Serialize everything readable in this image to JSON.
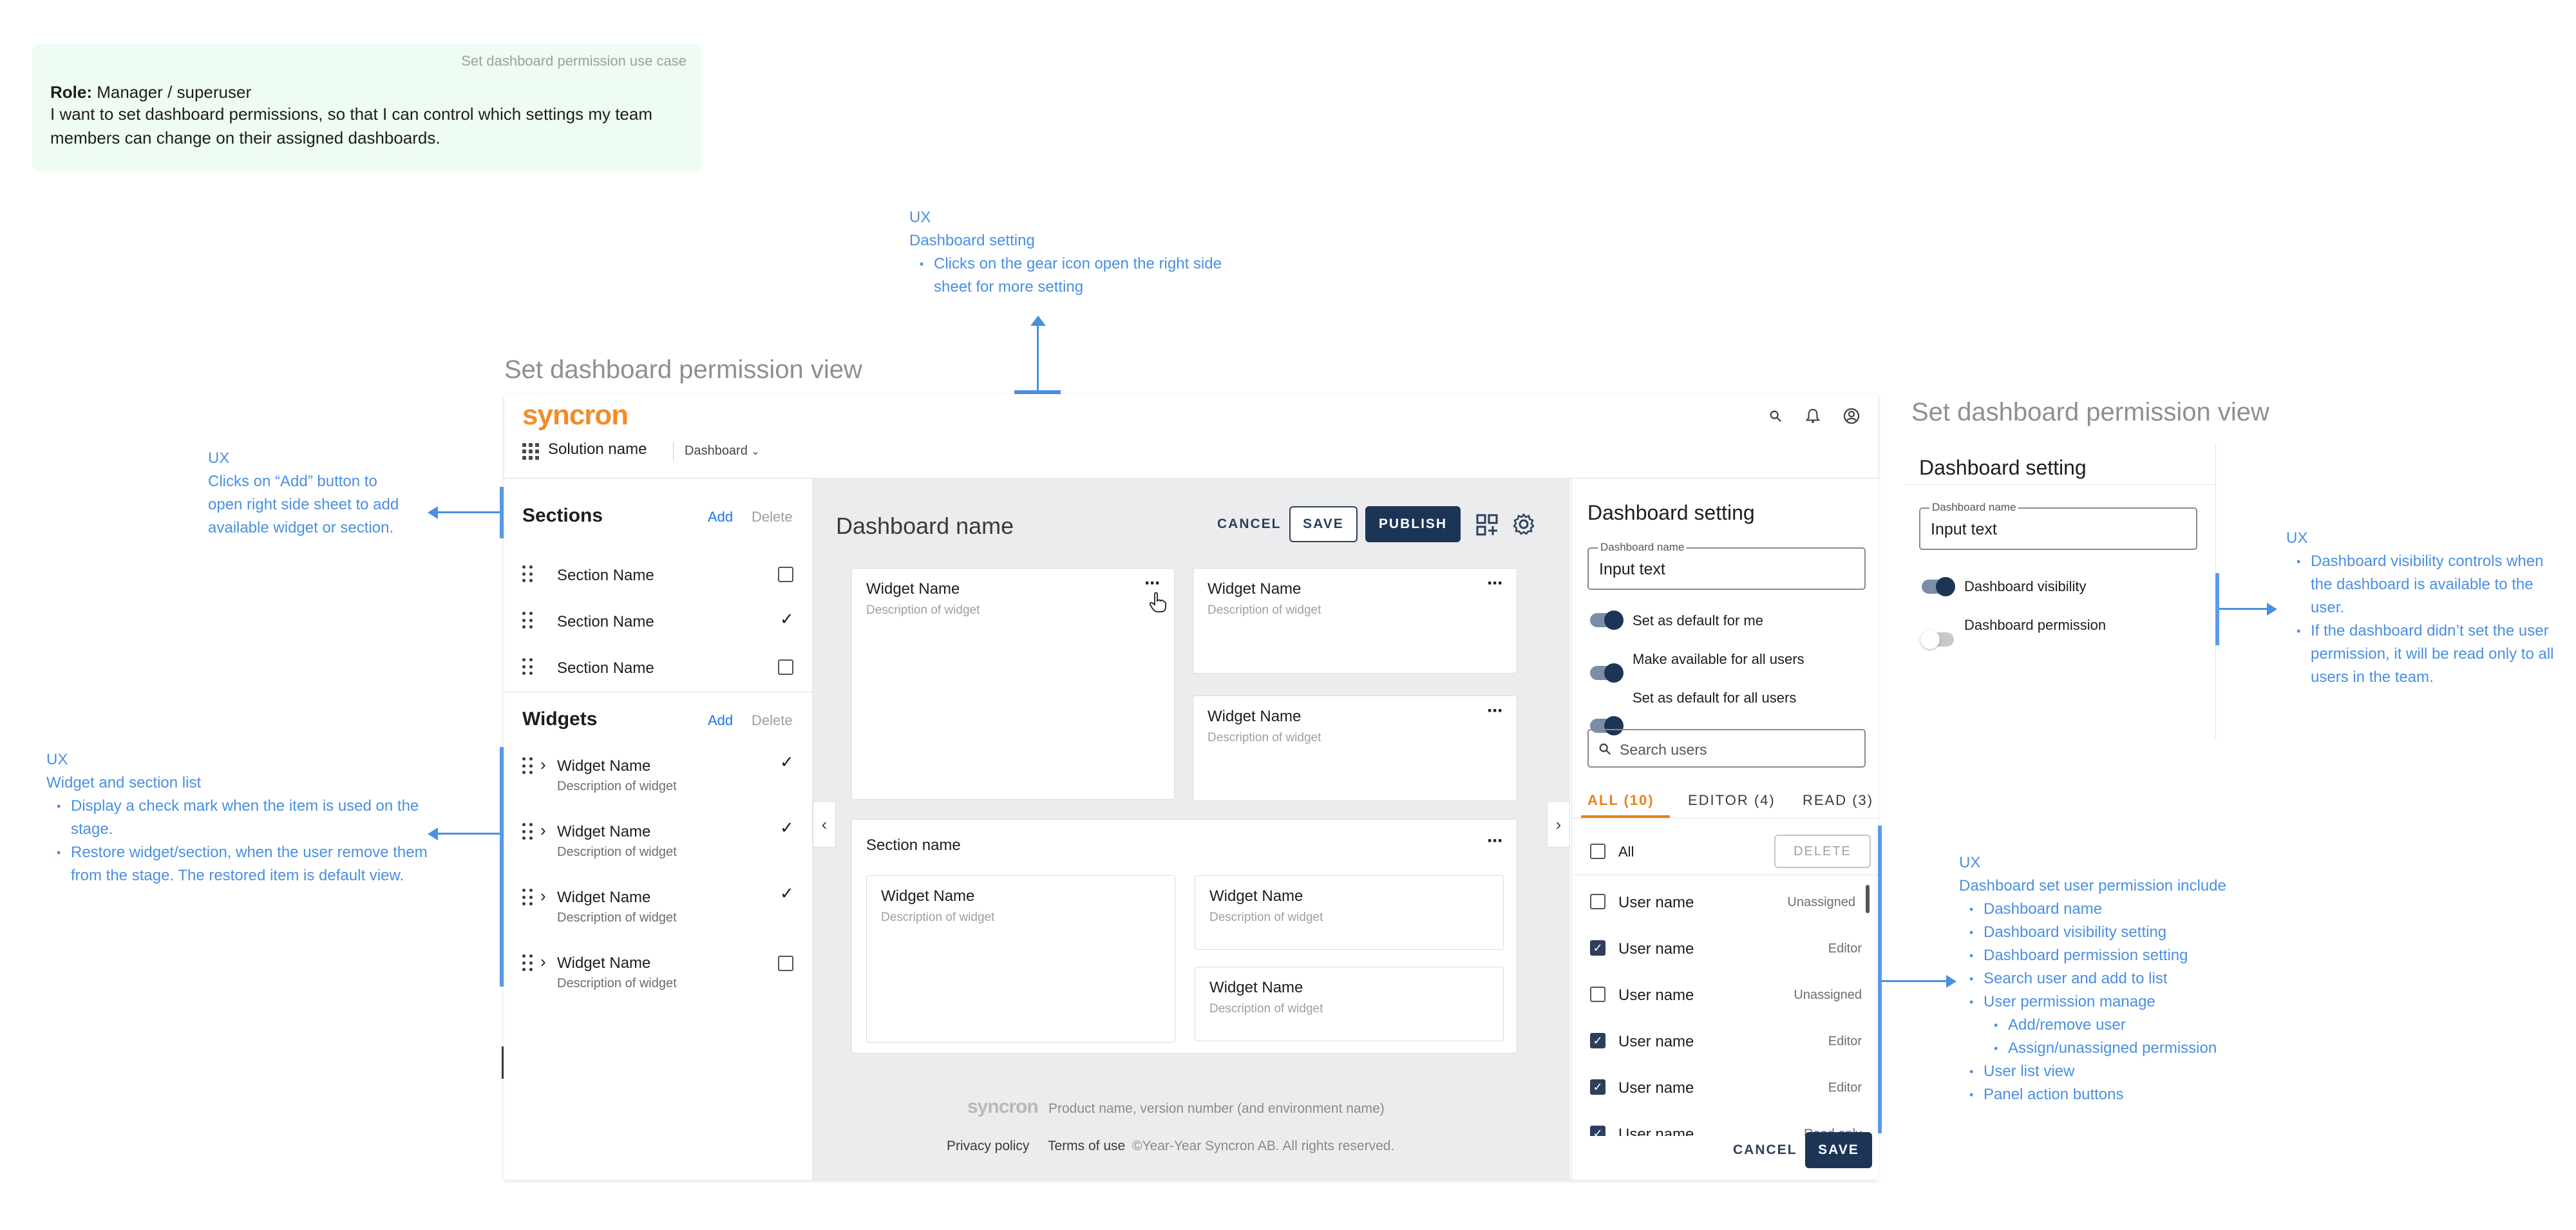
{
  "usecase": {
    "title": "Set dashboard permission use case",
    "role_label": "Role:",
    "role_value": " Manager /  superuser",
    "story": "I want to set dashboard permissions, so that I can control which settings my team members can change on their assigned dashboards."
  },
  "notes": {
    "gear": {
      "tag": "UX",
      "title": "Dashboard setting",
      "bullets": [
        "Clicks on the gear icon open the right side sheet for more setting"
      ]
    },
    "add": {
      "tag": "UX",
      "lines": [
        "Clicks on “Add” button to",
        "open right side sheet to add",
        "available widget or section."
      ]
    },
    "list": {
      "tag": "UX",
      "title": "Widget and section list",
      "bullets": [
        "Display a check mark when the item is used on the stage.",
        "Restore widget/section, when the user remove them from the stage. The restored item is default view."
      ]
    },
    "visibility": {
      "tag": "UX",
      "bullets": [
        "Dashboard visibility controls when the dashboard is available to the user.",
        "If the dashboard didn’t set the user permission, it will be read only to all users in the team."
      ]
    },
    "permission": {
      "tag": "UX",
      "title": "Dashboard set user permission include",
      "bullets": [
        "Dashboard name",
        "Dashboard visibility setting",
        "Dashboard permission setting",
        "Search user and add to list",
        "User permission manage"
      ],
      "sub_bullets": [
        "Add/remove user",
        "Assign/unassigned permission"
      ],
      "bullets_after": [
        "User list view",
        "Panel action buttons"
      ]
    }
  },
  "view_title_main": "Set dashboard permission view",
  "view_title_preview": "Set dashboard permission view",
  "app": {
    "logo": "syncron",
    "solution_name": "Solution name",
    "dashboard_select": "Dashboard",
    "icons": [
      "search-icon",
      "bell-icon",
      "account-icon"
    ],
    "sections": {
      "heading": "Sections",
      "add": "Add",
      "delete": "Delete",
      "items": [
        {
          "label": "Section Name",
          "state": "unchecked"
        },
        {
          "label": "Section Name",
          "state": "check"
        },
        {
          "label": "Section Name",
          "state": "unchecked"
        }
      ]
    },
    "widgets": {
      "heading": "Widgets",
      "add": "Add",
      "delete": "Delete",
      "items": [
        {
          "label": "Widget Name",
          "desc": "Description of widget",
          "state": "check"
        },
        {
          "label": "Widget Name",
          "desc": "Description of widget",
          "state": "check"
        },
        {
          "label": "Widget Name",
          "desc": "Description of widget",
          "state": "check"
        },
        {
          "label": "Widget Name",
          "desc": "Description of widget",
          "state": "unchecked"
        }
      ]
    },
    "stage": {
      "title": "Dashboard name",
      "cancel": "CANCEL",
      "save": "SAVE",
      "publish": "PUBLISH",
      "widgets": [
        {
          "name": "Widget Name",
          "desc": "Description of widget"
        },
        {
          "name": "Widget Name",
          "desc": "Description of widget"
        },
        {
          "name": "Widget Name",
          "desc": "Description of widget"
        }
      ],
      "section": {
        "name": "Section name",
        "widgets": [
          {
            "name": "Widget Name",
            "desc": "Description of widget"
          },
          {
            "name": "Widget Name",
            "desc": "Description of widget"
          },
          {
            "name": "Widget Name",
            "desc": "Description of widget"
          }
        ]
      },
      "footer": {
        "logo": "syncron",
        "product": "Product name, version number (and environment name)",
        "privacy": "Privacy policy",
        "terms": "Terms of use",
        "copyright": "©Year-Year Syncron AB. All rights reserved."
      }
    },
    "panel": {
      "title": "Dashboard setting",
      "name_label": "Dashboard name",
      "name_value": "Input text",
      "toggles": [
        {
          "label": "Set as default for me",
          "on": true
        },
        {
          "label": "Make available for all users",
          "on": true
        },
        {
          "label": "Set as default for all users",
          "on": true
        }
      ],
      "search_placeholder": "Search users",
      "tabs": [
        "ALL (10)",
        "EDITOR (4)",
        "READ (3)"
      ],
      "all_label": "All",
      "delete": "DELETE",
      "users": [
        {
          "name": "User name",
          "role": "Unassigned",
          "checked": false
        },
        {
          "name": "User name",
          "role": "Editor",
          "checked": true
        },
        {
          "name": "User name",
          "role": "Unassigned",
          "checked": false
        },
        {
          "name": "User name",
          "role": "Editor",
          "checked": true
        },
        {
          "name": "User name",
          "role": "Editor",
          "checked": true
        },
        {
          "name": "User name",
          "role": "Read only",
          "checked": true
        }
      ],
      "cancel": "CANCEL",
      "save": "SAVE"
    }
  },
  "preview": {
    "title": "Dashboard setting",
    "name_label": "Dashboard name",
    "name_value": "Input text",
    "toggles": [
      {
        "label": "Dashboard visibility",
        "on": true
      },
      {
        "label": "Dashboard permission",
        "on": false
      }
    ]
  },
  "colors": {
    "accent": "#1c3557",
    "brand": "#f28c28",
    "note": "#4a8fe2",
    "tab_active": "#e8821e"
  }
}
